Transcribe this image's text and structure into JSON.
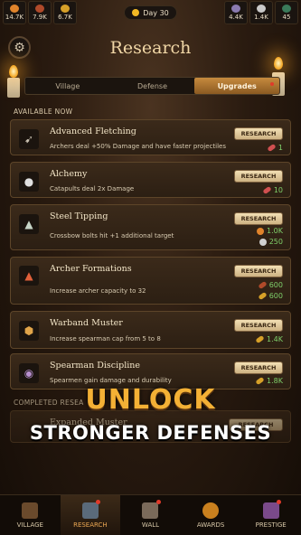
{
  "resources": [
    {
      "value": "14.7K",
      "icon": "food-icon",
      "color": "#e1842b"
    },
    {
      "value": "7.9K",
      "icon": "wood-icon",
      "color": "#b04a2a"
    },
    {
      "value": "6.7K",
      "icon": "gold-icon",
      "color": "#d6a028"
    }
  ],
  "day_label": "Day 30",
  "right_resources": [
    {
      "value": "4.4K",
      "icon": "crystal-icon",
      "color": "#8a7ab0"
    },
    {
      "value": "1.4K",
      "icon": "stone-icon",
      "color": "#c9c9c9"
    },
    {
      "value": "45",
      "icon": "gem-icon",
      "color": "#3a7a5a"
    }
  ],
  "header": {
    "title": "Research"
  },
  "tabs": [
    {
      "label": "Village",
      "active": false
    },
    {
      "label": "Defense",
      "active": false
    },
    {
      "label": "Upgrades",
      "active": true
    }
  ],
  "sections": {
    "available": "AVAILABLE NOW",
    "completed": "COMPLETED RESEA"
  },
  "cards": [
    {
      "name": "Advanced Fletching",
      "desc": "Archers deal +50% Damage and have faster projectiles",
      "button": "RESEARCH",
      "costs": [
        {
          "value": "1",
          "type": "gem",
          "color": "#d05050"
        }
      ]
    },
    {
      "name": "Alchemy",
      "desc": "Catapults deal 2x Damage",
      "button": "RESEARCH",
      "costs": [
        {
          "value": "10",
          "type": "gem",
          "color": "#d05050"
        }
      ]
    },
    {
      "name": "Steel Tipping",
      "desc": "Crossbow bolts hit +1 additional target",
      "button": "RESEARCH",
      "costs": [
        {
          "value": "1.0K",
          "type": "orb",
          "color": "#e1842b"
        },
        {
          "value": "250",
          "type": "orb",
          "color": "#d0d0d0"
        }
      ]
    },
    {
      "name": "Archer Formations",
      "desc": "Increase archer capacity to 32",
      "button": "RESEARCH",
      "costs": [
        {
          "value": "600",
          "type": "gem",
          "color": "#b04a2a"
        },
        {
          "value": "600",
          "type": "gem",
          "color": "#d6a028"
        }
      ]
    },
    {
      "name": "Warband Muster",
      "desc": "Increase spearman cap from 5 to 8",
      "button": "RESEARCH",
      "costs": [
        {
          "value": "1.4K",
          "type": "gem",
          "color": "#d6a028"
        }
      ]
    },
    {
      "name": "Spearman Discipline",
      "desc": "Spearmen gain damage and durability",
      "button": "RESEARCH",
      "costs": [
        {
          "value": "1.8K",
          "type": "gem",
          "color": "#d6a028"
        }
      ]
    }
  ],
  "completed_card": {
    "name": "Expanded Muster",
    "button": "RESEARCH"
  },
  "promo": {
    "line1": "UNLOCK",
    "line2": "STRONGER DEFENSES"
  },
  "nav": [
    {
      "label": "VILLAGE",
      "active": false
    },
    {
      "label": "RESEARCH",
      "active": true
    },
    {
      "label": "WALL",
      "active": false
    },
    {
      "label": "AWARDS",
      "active": false
    },
    {
      "label": "PRESTIGE",
      "active": false
    }
  ]
}
